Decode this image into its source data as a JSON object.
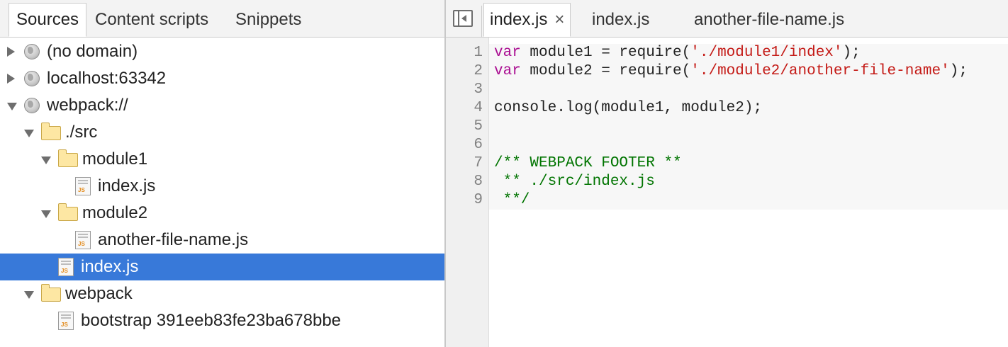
{
  "navigator": {
    "tabs": [
      {
        "label": "Sources",
        "active": true
      },
      {
        "label": "Content scripts",
        "active": false
      },
      {
        "label": "Snippets",
        "active": false
      }
    ],
    "tree": [
      {
        "label": "(no domain)",
        "icon": "globe-icon",
        "state": "collapsed",
        "depth": 0,
        "selected": false
      },
      {
        "label": "localhost:63342",
        "icon": "globe-icon",
        "state": "collapsed",
        "depth": 0,
        "selected": false
      },
      {
        "label": "webpack://",
        "icon": "globe-icon",
        "state": "expanded",
        "depth": 0,
        "selected": false
      },
      {
        "label": "./src",
        "icon": "folder-icon",
        "state": "expanded",
        "depth": 1,
        "selected": false
      },
      {
        "label": "module1",
        "icon": "folder-icon",
        "state": "expanded",
        "depth": 2,
        "selected": false
      },
      {
        "label": "index.js",
        "icon": "js-file-icon",
        "state": "leaf",
        "depth": 3,
        "selected": false
      },
      {
        "label": "module2",
        "icon": "folder-icon",
        "state": "expanded",
        "depth": 2,
        "selected": false
      },
      {
        "label": "another-file-name.js",
        "icon": "js-file-icon",
        "state": "leaf",
        "depth": 3,
        "selected": false
      },
      {
        "label": "index.js",
        "icon": "js-file-icon",
        "state": "leaf",
        "depth": 2,
        "selected": true
      },
      {
        "label": "webpack",
        "icon": "folder-icon",
        "state": "expanded",
        "depth": 1,
        "selected": false
      },
      {
        "label": "bootstrap 391eeb83fe23ba678bbe",
        "icon": "js-file-icon",
        "state": "leaf",
        "depth": 2,
        "selected": false
      }
    ],
    "file_icon_tag": "JS"
  },
  "editor": {
    "tabs": [
      {
        "label": "index.js",
        "active": true,
        "close_glyph": "×"
      },
      {
        "label": "index.js",
        "active": false
      },
      {
        "label": "another-file-name.js",
        "active": false
      }
    ],
    "lines": [
      {
        "number": "1",
        "tokens": [
          {
            "type": "keyword",
            "text": "var"
          },
          {
            "type": "plain",
            "text": " module1 = require("
          },
          {
            "type": "string",
            "text": "'./module1/index'"
          },
          {
            "type": "plain",
            "text": ");"
          }
        ]
      },
      {
        "number": "2",
        "tokens": [
          {
            "type": "keyword",
            "text": "var"
          },
          {
            "type": "plain",
            "text": " module2 = require("
          },
          {
            "type": "string",
            "text": "'./module2/another-file-name'"
          },
          {
            "type": "plain",
            "text": ");"
          }
        ]
      },
      {
        "number": "3",
        "tokens": []
      },
      {
        "number": "4",
        "tokens": [
          {
            "type": "plain",
            "text": "console.log(module1, module2);"
          }
        ]
      },
      {
        "number": "5",
        "tokens": []
      },
      {
        "number": "6",
        "tokens": []
      },
      {
        "number": "7",
        "tokens": [
          {
            "type": "comment",
            "text": "/** WEBPACK FOOTER **"
          }
        ]
      },
      {
        "number": "8",
        "tokens": [
          {
            "type": "comment",
            "text": " ** ./src/index.js"
          }
        ]
      },
      {
        "number": "9",
        "tokens": [
          {
            "type": "comment",
            "text": " **/"
          }
        ]
      }
    ]
  },
  "colors": {
    "selection": "#3879d9",
    "keyword": "#aa0d91",
    "string": "#c41a16",
    "comment": "#007400"
  }
}
